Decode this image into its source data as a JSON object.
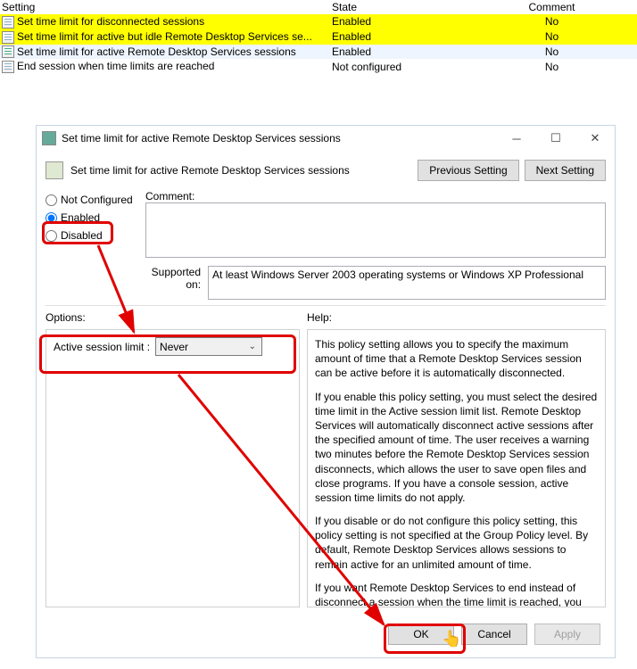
{
  "table": {
    "headers": {
      "setting": "Setting",
      "state": "State",
      "comment": "Comment"
    },
    "rows": [
      {
        "setting": "Set time limit for disconnected sessions",
        "state": "Enabled",
        "comment": "No",
        "yellow": true
      },
      {
        "setting": "Set time limit for active but idle Remote Desktop Services se...",
        "state": "Enabled",
        "comment": "No",
        "yellow": true
      },
      {
        "setting": "Set time limit for active Remote Desktop Services sessions",
        "state": "Enabled",
        "comment": "No",
        "yellow": true,
        "selected": true
      },
      {
        "setting": "End session when time limits are reached",
        "state": "Not configured",
        "comment": "No"
      }
    ]
  },
  "dialog": {
    "title": "Set time limit for active Remote Desktop Services sessions",
    "heading": "Set time limit for active Remote Desktop Services sessions",
    "prev_btn": "Previous Setting",
    "next_btn": "Next Setting",
    "radio": {
      "not_configured": "Not Configured",
      "enabled": "Enabled",
      "disabled": "Disabled"
    },
    "comment_label": "Comment:",
    "supported_label": "Supported on:",
    "supported_text": "At least Windows Server 2003 operating systems or Windows XP Professional",
    "options_label": "Options:",
    "help_label": "Help:",
    "option": {
      "label": "Active session limit :",
      "value": "Never"
    },
    "help_paragraphs": [
      "This policy setting allows you to specify the maximum amount of time that a Remote Desktop Services session can be active before it is automatically disconnected.",
      "If you enable this policy setting, you must select the desired time limit in the Active session limit list. Remote Desktop Services will automatically disconnect active sessions after the specified amount of time. The user receives a warning two minutes before the Remote Desktop Services session disconnects, which allows the user to save open files and close programs. If you have a console session, active session time limits do not apply.",
      "If you disable or do not configure this policy setting, this policy setting is not specified at the Group Policy level. By default, Remote Desktop Services allows sessions to remain active for an unlimited amount of time.",
      "If you want Remote Desktop Services to end instead of disconnect a session when the time limit is reached, you can configure the policy setting Computer Configuration\\Administrative Templates\\Windows Components\\Remote"
    ],
    "footer": {
      "ok": "OK",
      "cancel": "Cancel",
      "apply": "Apply"
    }
  }
}
